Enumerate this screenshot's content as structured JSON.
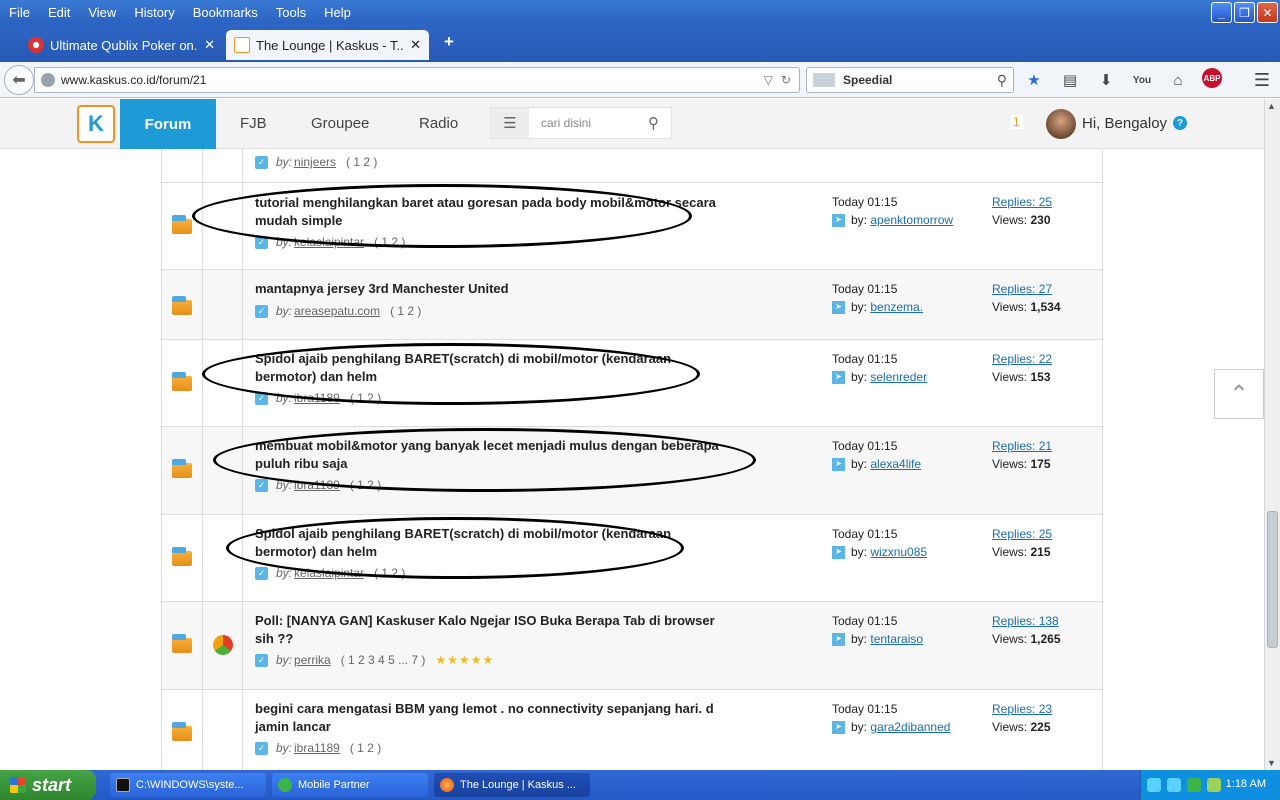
{
  "menubar": {
    "items": [
      "File",
      "Edit",
      "View",
      "History",
      "Bookmarks",
      "Tools",
      "Help"
    ]
  },
  "tabs": [
    {
      "title": "Ultimate Qublix Poker on...",
      "active": false
    },
    {
      "title": "The Lounge | Kaskus - T...",
      "active": true
    }
  ],
  "navbar": {
    "url": "www.kaskus.co.id/forum/21",
    "search_value": "Speedial"
  },
  "site": {
    "nav": [
      "Forum",
      "FJB",
      "Groupee",
      "Radio"
    ],
    "search_placeholder": "cari disini",
    "notification_count": "1",
    "greeting": "Hi, Bengaloy",
    "help": "?"
  },
  "labels": {
    "by_prefix": "by:",
    "lastpost_by": "by:",
    "replies_prefix": "Replies:",
    "views_prefix": "Views:"
  },
  "partial_row": {
    "author": "ninjeers",
    "pages": "( 1 2 )"
  },
  "threads": [
    {
      "title": "tutorial menghilangkan baret atau goresan pada body mobil&motor secara mudah simple",
      "author": "kelaslaipintar",
      "pages": "( 1 2 )",
      "time": "Today 01:15",
      "last_by": "apenktomorrow",
      "replies": "25",
      "views": "230",
      "poll": false,
      "stars": ""
    },
    {
      "title": "mantapnya jersey 3rd Manchester United",
      "author": "areasepatu.com",
      "pages": "( 1 2 )",
      "time": "Today 01:15",
      "last_by": "benzema.",
      "replies": "27",
      "views": "1,534",
      "poll": false,
      "stars": ""
    },
    {
      "title": "Spidol ajaib penghilang BARET(scratch) di mobil/motor (kendaraan bermotor) dan helm",
      "author": "ibra1189",
      "pages": "( 1 2 )",
      "time": "Today 01:15",
      "last_by": "selenreder",
      "replies": "22",
      "views": "153",
      "poll": false,
      "stars": ""
    },
    {
      "title": "membuat mobil&motor yang banyak lecet menjadi mulus dengan beberapa puluh ribu saja",
      "author": "ibra1189",
      "pages": "( 1 2 )",
      "time": "Today 01:15",
      "last_by": "alexa4life",
      "replies": "21",
      "views": "175",
      "poll": false,
      "stars": ""
    },
    {
      "title": "Spidol ajaib penghilang BARET(scratch) di mobil/motor (kendaraan bermotor) dan helm",
      "author": "kelaslaipintar",
      "pages": "( 1 2 )",
      "time": "Today 01:15",
      "last_by": "wizxnu085",
      "replies": "25",
      "views": "215",
      "poll": false,
      "stars": ""
    },
    {
      "title": "Poll: [NANYA GAN] Kaskuser Kalo Ngejar ISO Buka Berapa Tab di browser sih ??",
      "author": "perrika",
      "pages": "( 1 2 3 4 5 ... 7 )",
      "time": "Today 01:15",
      "last_by": "tentaraiso",
      "replies": "138",
      "views": "1,265",
      "poll": true,
      "stars": "★★★★★"
    },
    {
      "title": "begini cara mengatasi BBM yang lemot . no connectivity sepanjang hari. d jamin lancar",
      "author": "ibra1189",
      "pages": "( 1 2 )",
      "time": "Today 01:15",
      "last_by": "gara2dibanned",
      "replies": "23",
      "views": "225",
      "poll": false,
      "stars": ""
    }
  ],
  "taskbar": {
    "start": "start",
    "tasks": [
      "C:\\WINDOWS\\syste...",
      "Mobile Partner",
      "The Lounge | Kaskus ..."
    ],
    "clock": "1:18 AM"
  },
  "colors": {
    "kaskus_blue": "#1e9ad6",
    "link_blue": "#1a6db3",
    "xp_blue": "#245ac6"
  }
}
